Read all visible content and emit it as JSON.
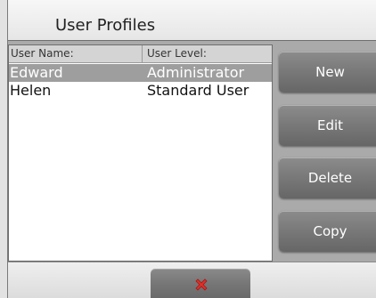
{
  "window": {
    "title": "User Profiles"
  },
  "user_list": {
    "columns": [
      "User Name:",
      "User Level:"
    ],
    "rows": [
      {
        "name": "Edward",
        "level": "Administrator",
        "selected": true
      },
      {
        "name": "Helen",
        "level": "Standard User",
        "selected": false
      }
    ]
  },
  "actions": {
    "new_label": "New",
    "edit_label": "Edit",
    "delete_label": "Delete",
    "copy_label": "Copy"
  },
  "footer": {
    "close_icon": "close-icon",
    "close_icon_color": "#e0302a"
  },
  "colors": {
    "selected_row": "#9e9e9e",
    "button": "#7a7a7a"
  }
}
